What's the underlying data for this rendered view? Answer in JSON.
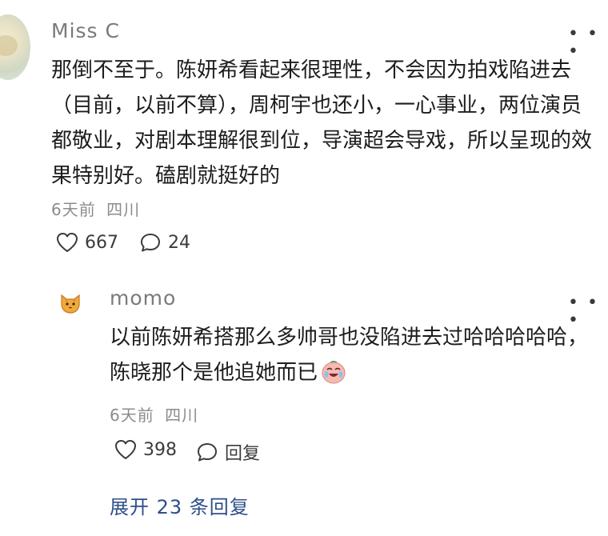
{
  "comment": {
    "username": "Miss C",
    "text": "那倒不至于。陈妍希看起来很理性，不会因为拍戏陷进去（目前，以前不算），周柯宇也还小，一心事业，两位演员都敬业，对剧本理解很到位，导演超会导戏，所以呈现的效果特别好。磕剧就挺好的",
    "time": "6天前",
    "location": "四川",
    "likes": "667",
    "replies": "24",
    "more_icon": "more-dots-icon"
  },
  "reply": {
    "username": "momo",
    "text": "以前陈妍希搭那么多帅哥也没陷进去过哈哈哈哈哈，陈晓那个是他追她而已",
    "emoji_icon": "crying-laughing-face-icon",
    "time": "6天前",
    "location": "四川",
    "likes": "398",
    "reply_label": "回复",
    "more_icon": "more-dots-icon"
  },
  "expand_label": "展开 23 条回复",
  "colors": {
    "username": "#7a7a7a",
    "meta": "#8c8c8c",
    "link": "#2d4f8a",
    "text": "#1d1d1d"
  }
}
